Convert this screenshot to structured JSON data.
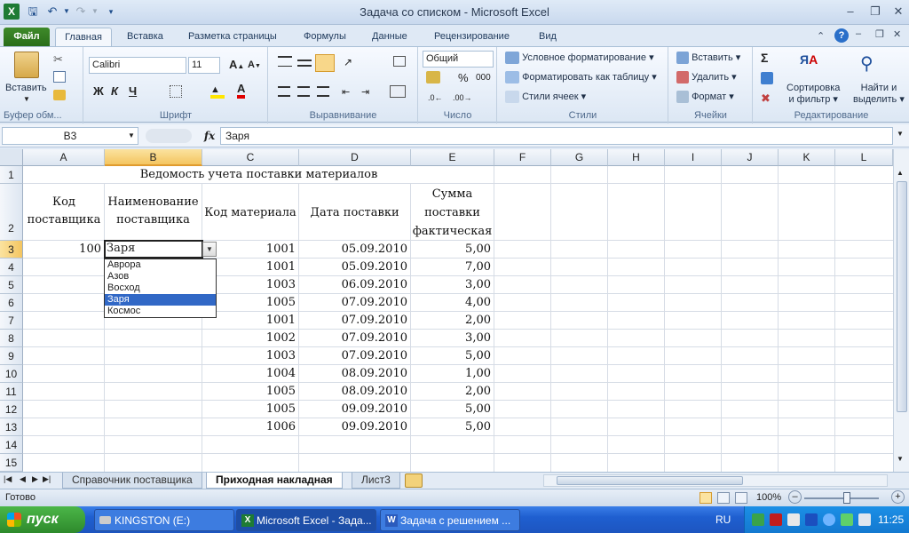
{
  "window": {
    "title": "Задача со списком - Microsoft Excel"
  },
  "ribbon": {
    "tabs": [
      "Файл",
      "Главная",
      "Вставка",
      "Разметка страницы",
      "Формулы",
      "Данные",
      "Рецензирование",
      "Вид"
    ],
    "clipboard": {
      "paste": "Вставить",
      "group": "Буфер обм..."
    },
    "font": {
      "name": "Calibri",
      "size": "11",
      "bold": "Ж",
      "italic": "К",
      "underline": "Ч",
      "group": "Шрифт"
    },
    "alignment": {
      "group": "Выравнивание"
    },
    "number": {
      "format": "Общий",
      "percent": "%",
      "thousands": "000",
      "group": "Число"
    },
    "styles": {
      "conditional": "Условное форматирование",
      "as_table": "Форматировать как таблицу",
      "cell_styles": "Стили ячеек",
      "group": "Стили"
    },
    "cells": {
      "insert": "Вставить",
      "delete": "Удалить",
      "format": "Формат",
      "group": "Ячейки"
    },
    "editing": {
      "sigma": "Σ",
      "sort": "Сортировка",
      "sort2": "и фильтр",
      "find": "Найти и",
      "find2": "выделить",
      "group": "Редактирование"
    }
  },
  "formula_bar": {
    "name_box": "B3",
    "fx": "fx",
    "content": "Заря"
  },
  "sheet": {
    "columns": [
      "A",
      "B",
      "C",
      "D",
      "E",
      "F",
      "G",
      "H",
      "I",
      "J",
      "K",
      "L"
    ],
    "rows": [
      "1",
      "2",
      "3",
      "4",
      "5",
      "6",
      "7",
      "8",
      "9",
      "10",
      "11",
      "12",
      "13",
      "14",
      "15"
    ],
    "title": "Ведомость учета поставки материалов",
    "headers": {
      "a": [
        "Код",
        "поставщика"
      ],
      "b": [
        "Наименование",
        "поставщика"
      ],
      "c": "Код материала",
      "d": "Дата поставки",
      "e": [
        "Сумма",
        "поставки",
        "фактическая"
      ]
    },
    "data": [
      {
        "a": "100",
        "b": "Заря",
        "c": "1001",
        "d": "05.09.2010",
        "e": "5,00"
      },
      {
        "a": "",
        "b": "",
        "c": "1001",
        "d": "05.09.2010",
        "e": "7,00"
      },
      {
        "a": "",
        "b": "",
        "c": "1003",
        "d": "06.09.2010",
        "e": "3,00"
      },
      {
        "a": "",
        "b": "",
        "c": "1005",
        "d": "07.09.2010",
        "e": "4,00"
      },
      {
        "a": "",
        "b": "",
        "c": "1001",
        "d": "07.09.2010",
        "e": "2,00"
      },
      {
        "a": "",
        "b": "",
        "c": "1002",
        "d": "07.09.2010",
        "e": "3,00"
      },
      {
        "a": "",
        "b": "",
        "c": "1003",
        "d": "07.09.2010",
        "e": "5,00"
      },
      {
        "a": "",
        "b": "",
        "c": "1004",
        "d": "08.09.2010",
        "e": "1,00"
      },
      {
        "a": "",
        "b": "",
        "c": "1005",
        "d": "08.09.2010",
        "e": "2,00"
      },
      {
        "a": "",
        "b": "",
        "c": "1005",
        "d": "09.09.2010",
        "e": "5,00"
      },
      {
        "a": "",
        "b": "",
        "c": "1006",
        "d": "09.09.2010",
        "e": "5,00"
      }
    ],
    "dropdown": {
      "options": [
        "Аврора",
        "Азов",
        "Восход",
        "Заря",
        "Космос"
      ],
      "selected": "Заря"
    }
  },
  "sheet_tabs": [
    "Справочник поставщика",
    "Приходная накладная",
    "Лист3"
  ],
  "active_sheet": "Приходная накладная",
  "status": {
    "ready": "Готово",
    "zoom": "100%"
  },
  "taskbar": {
    "start": "пуск",
    "items": [
      "KINGSTON (E:)",
      "Microsoft Excel - Зада...",
      "Задача с решением ..."
    ],
    "lang": "RU",
    "clock": "11:25"
  },
  "colors": {
    "excel_green": "#2a6e1a",
    "selection": "#3168c6",
    "header_selected": "#f4c560"
  }
}
